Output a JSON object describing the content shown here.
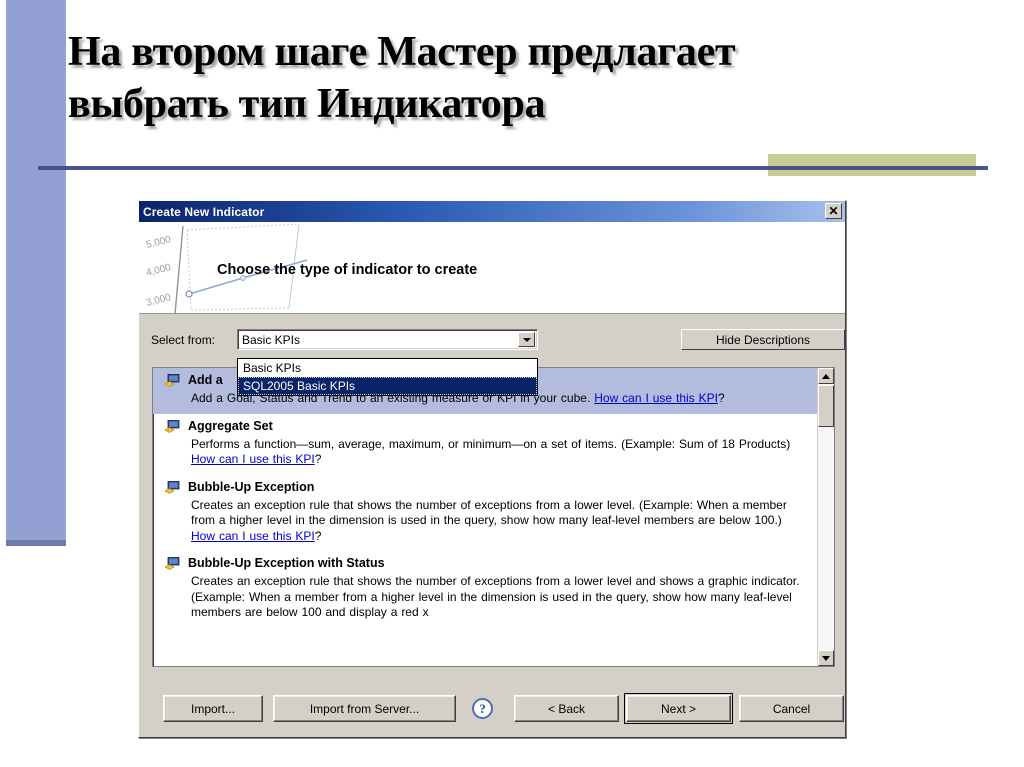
{
  "slide": {
    "title_line1": "На втором шаге Мастер предлагает",
    "title_line2": "выбрать тип Индикатора",
    "accent_left": "#93a0d3",
    "accent_olive": "#c9cb94",
    "accent_rule": "#4c5291"
  },
  "dialog": {
    "title": "Create New Indicator",
    "close_label": "✕",
    "banner": {
      "heading": "Choose the type of indicator to create",
      "chart_axis_labels": [
        "5,000",
        "4,000",
        "3,000"
      ]
    },
    "select_from": {
      "label": "Select from:",
      "value": "Basic KPIs",
      "options": [
        "Basic KPIs",
        "SQL2005 Basic KPIs"
      ],
      "highlighted_option": "SQL2005 Basic KPIs"
    },
    "hide_descriptions_label": "Hide Descriptions",
    "list": {
      "items": [
        {
          "title": "Add a Goal, Status and Trend to a measure",
          "title_visible": "Add a",
          "desc_pre": "Add a Goal, Status and Trend to an existing measure or KPI in your cube. ",
          "link": "How can I use this KPI",
          "desc_post": "?",
          "selected": true
        },
        {
          "title": "Aggregate Set",
          "desc_pre": "Performs a function—sum, average, maximum, or minimum—on a set of items. (Example: Sum of 18 Products) ",
          "link": "How can I use this KPI",
          "desc_post": "?",
          "selected": false
        },
        {
          "title": "Bubble-Up Exception",
          "desc_pre": "Creates an exception rule that shows the number of exceptions from a lower level. (Example: When a member from a higher level in the dimension is used in the query, show how many leaf-level members are below 100.) ",
          "link": "How can I use this KPI",
          "desc_post": "?",
          "selected": false
        },
        {
          "title": "Bubble-Up Exception with Status",
          "desc_pre": "Creates an exception rule that shows the number of exceptions from a lower level and shows a graphic indicator. (Example: When a member from a higher level in the dimension is used in the query, show how many leaf-level members are below 100 and display a red x",
          "link": "",
          "desc_post": "",
          "selected": false
        }
      ]
    },
    "buttons": {
      "import": "Import...",
      "import_from_server": "Import from Server...",
      "help": "?",
      "back": "< Back",
      "next": "Next >",
      "cancel": "Cancel"
    }
  }
}
